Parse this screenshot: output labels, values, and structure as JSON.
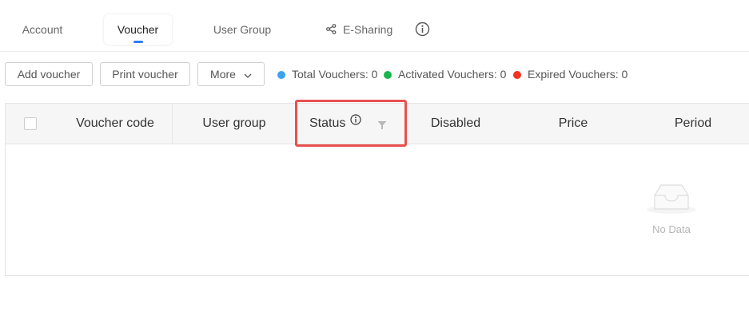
{
  "tabs": [
    {
      "label": "Account",
      "active": false
    },
    {
      "label": "Voucher",
      "active": true
    },
    {
      "label": "User Group",
      "active": false
    },
    {
      "label": "E-Sharing",
      "active": false,
      "icon": "share-icon"
    }
  ],
  "tabs_info_icon": "info-circle-icon",
  "toolbar": {
    "add_voucher": "Add voucher",
    "print_voucher": "Print voucher",
    "more": "More"
  },
  "stats": [
    {
      "label": "Total Vouchers: 0",
      "color": "#3ba2f2"
    },
    {
      "label": "Activated Vouchers: 0",
      "color": "#19b64f"
    },
    {
      "label": "Expired Vouchers: 0",
      "color": "#f2331f"
    }
  ],
  "table": {
    "columns": [
      "Voucher code",
      "User group",
      "Status",
      "Disabled",
      "Price",
      "Period"
    ],
    "rows": [],
    "empty_text": "No Data"
  },
  "highlight_color": "#e8504f",
  "accent_color": "#2f7bff"
}
